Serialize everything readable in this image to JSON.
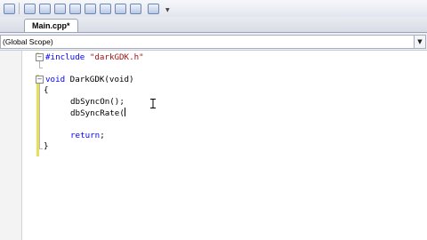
{
  "toolbar": {
    "icons": [
      "new-file-icon",
      "open-file-icon",
      "save-icon",
      "save-all-icon",
      "cut-icon",
      "copy-icon",
      "paste-icon",
      "undo-icon",
      "redo-icon"
    ]
  },
  "tabs": [
    {
      "label": "Main.cpp*",
      "active": true
    }
  ],
  "scope": {
    "value": "(Global Scope)"
  },
  "code": {
    "include_kw": "#include",
    "include_file": "\"darkGDK.h\"",
    "void_kw": "void",
    "func_sig": " DarkGDK(void)",
    "open_brace": "{",
    "line_sync_on": "dbSyncOn();",
    "line_sync_rate": "dbSyncRate(",
    "return_kw": "return",
    "return_semicolon": ";",
    "close_brace": "}"
  },
  "colors": {
    "keyword": "#0000ff",
    "string": "#a31515",
    "changebar": "#e5df5c"
  }
}
